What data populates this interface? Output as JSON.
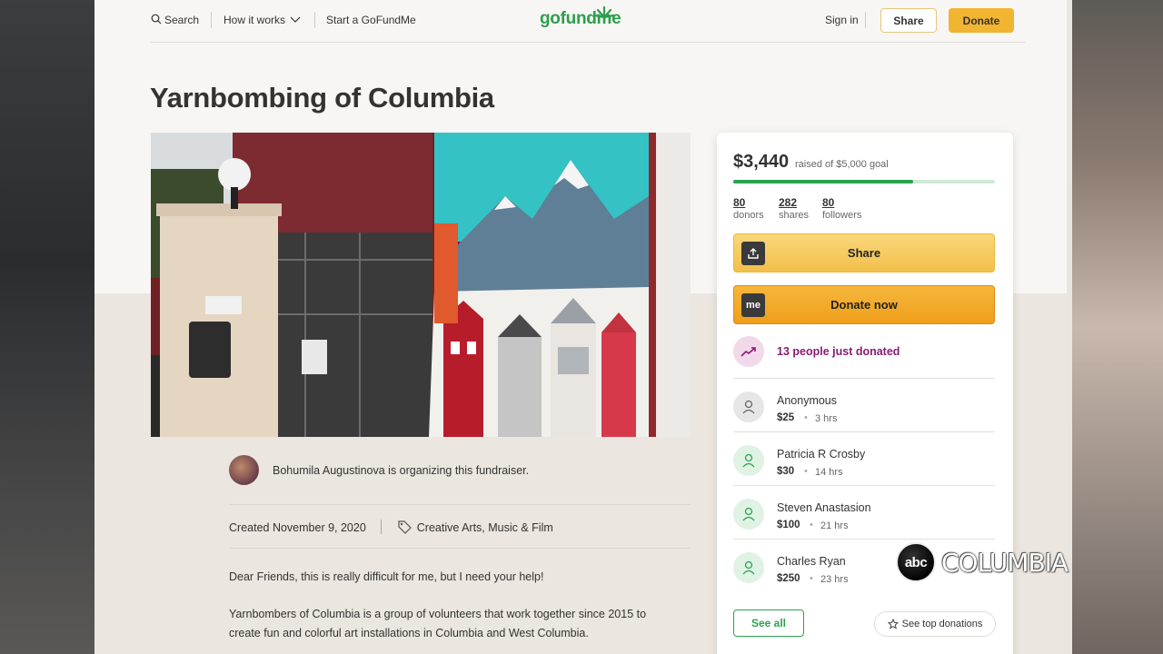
{
  "nav": {
    "search": "Search",
    "how_it_works": "How it works",
    "start": "Start a GoFundMe",
    "logo": "gofundme",
    "sign_in": "Sign in",
    "share": "Share",
    "donate": "Donate"
  },
  "campaign": {
    "title": "Yarnbombing of Columbia",
    "organizer": "Bohumila Augustinova is organizing this fundraiser.",
    "created": "Created November 9, 2020",
    "category": "Creative Arts, Music & Film",
    "paragraph1": "Dear Friends, this is really difficult for me, but I need your help!",
    "paragraph2_line1": "Yarnbombers of Columbia is a group of volunteers that work together since 2015 to",
    "paragraph2_line2": "create fun and colorful art installations in Columbia and West Columbia."
  },
  "card": {
    "raised": "$3,440",
    "goal": "raised of $5,000 goal",
    "progress_fraction": 0.688,
    "stats": [
      {
        "value": "80",
        "label": "donors"
      },
      {
        "value": "282",
        "label": "shares"
      },
      {
        "value": "80",
        "label": "followers"
      }
    ],
    "share_label": "Share",
    "donate_label": "Donate now",
    "trend": "13 people just donated",
    "donors": [
      {
        "name": "Anonymous",
        "amount": "$25",
        "time": "3 hrs"
      },
      {
        "name": "Patricia R Crosby",
        "amount": "$30",
        "time": "14 hrs"
      },
      {
        "name": "Steven Anastasion",
        "amount": "$100",
        "time": "21 hrs"
      },
      {
        "name": "Charles Ryan",
        "amount": "$250",
        "time": "23 hrs"
      }
    ],
    "see_all": "See all",
    "see_top": "See top donations"
  },
  "watermark": {
    "network": "abc",
    "station": "COLUMBIA"
  },
  "colors": {
    "brand_green": "#2aa350",
    "donate_orange": "#f2b531",
    "trend_purple": "#8a1b73"
  }
}
